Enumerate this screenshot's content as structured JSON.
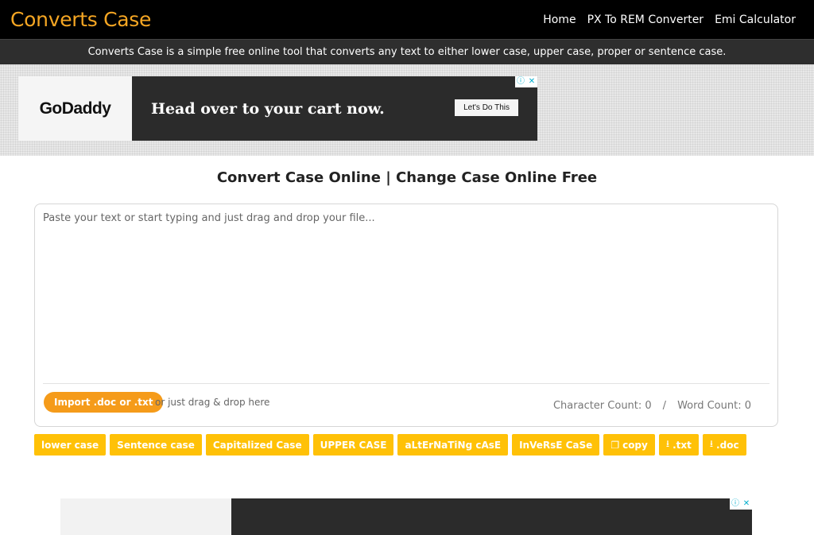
{
  "header": {
    "brand": "Converts Case",
    "nav": [
      "Home",
      "PX To REM Converter",
      "Emi Calculator"
    ],
    "tagline": "Converts Case is a simple free online tool that converts any text to either lower case, upper case, proper or sentence case."
  },
  "ad": {
    "logo": "GoDaddy",
    "headline": "Head over to your cart now.",
    "cta": "Let's Do This",
    "info_icon": "ⓘ",
    "close_icon": "✕"
  },
  "main": {
    "title": "Convert Case Online | Change Case Online Free",
    "editor_placeholder": "Paste your text or start typing and just drag and drop your file...",
    "import_label": "Import .doc or .txt",
    "drag_hint": "or just drag & drop here",
    "char_count": "Character Count: 0",
    "separator": "/",
    "word_count": "Word Count: 0"
  },
  "buttons": {
    "lower": "lower case",
    "sentence": "Sentence case",
    "capitalized": "Capitalized Case",
    "upper": "UPPER CASE",
    "alternating": "aLtErNaTiNg cAsE",
    "inverse": "InVeRsE CaSe",
    "copy": "copy",
    "txt": ".txt",
    "doc": ".doc"
  },
  "icons": {
    "copy": "copy-icon",
    "download": "download-icon"
  },
  "colors": {
    "brand": "#f5a623",
    "button": "#ffc107",
    "import": "#f59b1a"
  }
}
